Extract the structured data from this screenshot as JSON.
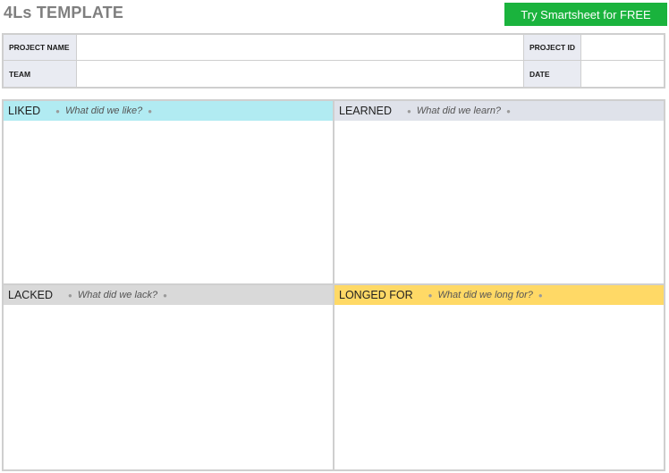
{
  "header": {
    "title": "4Ls TEMPLATE",
    "cta_label": "Try Smartsheet for FREE"
  },
  "info": {
    "project_name_label": "PROJECT NAME",
    "project_name_value": "",
    "project_id_label": "PROJECT ID",
    "project_id_value": "",
    "team_label": "TEAM",
    "team_value": "",
    "date_label": "DATE",
    "date_value": ""
  },
  "quadrants": [
    {
      "title": "LIKED",
      "prompt": "What did we like?",
      "color": "#b1ebf2"
    },
    {
      "title": "LEARNED",
      "prompt": "What did we learn?",
      "color": "#dfe2ea"
    },
    {
      "title": "LACKED",
      "prompt": "What did we lack?",
      "color": "#d9d9d9"
    },
    {
      "title": "LONGED FOR",
      "prompt": "What did we long for?",
      "color": "#ffd966"
    }
  ],
  "colors": {
    "cta_green": "#1ab33d",
    "title_gray": "#7f7f7f",
    "label_bg": "#e9ebf2"
  }
}
